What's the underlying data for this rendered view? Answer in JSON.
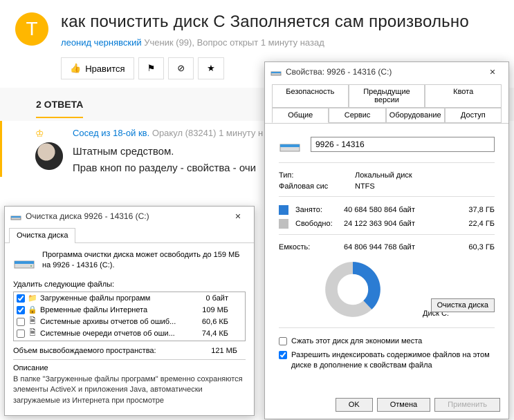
{
  "qa": {
    "avatar_letter": "Т",
    "title": "как почистить диск С Заполняется сам произвольно",
    "author": "леонид чернявский",
    "author_meta": "Ученик (99), Вопрос открыт 1 минуту назад",
    "like_label": "Нравится",
    "answers_label": "2 ОТВЕТА"
  },
  "answer": {
    "name": "Сосед из 18-ой кв.",
    "rank": "Оракул (83241)",
    "time": "1 минуту н",
    "line1": "Штатным средством.",
    "line2": "Прав кноп по разделу - свойства - очи"
  },
  "cleanup": {
    "title": "Очистка диска 9926 - 14316 (C:)",
    "tab": "Очистка диска",
    "info": "Программа очистки диска может освободить до 159 МБ на 9926 - 14316 (C:).",
    "list_label": "Удалить следующие файлы:",
    "items": [
      {
        "checked": true,
        "name": "Загруженные файлы программ",
        "size": "0 байт",
        "icon": "folder"
      },
      {
        "checked": true,
        "name": "Временные файлы Интернета",
        "size": "109 МБ",
        "icon": "lock"
      },
      {
        "checked": false,
        "name": "Системные архивы отчетов об ошиб...",
        "size": "60,6 КБ",
        "icon": "file"
      },
      {
        "checked": false,
        "name": "Системные очереди отчетов об оши...",
        "size": "74,4 КБ",
        "icon": "file"
      }
    ],
    "freed_label": "Объем высвобождаемого пространства:",
    "freed_value": "121 МБ",
    "desc_label": "Описание",
    "desc_text": "В папке \"Загруженные файлы программ\" временно сохраняются элементы ActiveX и приложения Java, автоматически загружаемые из Интернета при просмотре"
  },
  "props": {
    "title": "Свойства: 9926 - 14316 (C:)",
    "tabs_top": [
      "Безопасность",
      "Предыдущие версии",
      "Квота"
    ],
    "tabs_bottom": [
      "Общие",
      "Сервис",
      "Оборудование",
      "Доступ"
    ],
    "name_value": "9926 - 14316",
    "type_label": "Тип:",
    "type_value": "Локальный диск",
    "fs_label": "Файловая сис",
    "fs_value": "NTFS",
    "used_label": "Занято:",
    "used_bytes": "40 684 580 864 байт",
    "used_gb": "37,8 ГБ",
    "free_label": "Свободно:",
    "free_bytes": "24 122 363 904 байт",
    "free_gb": "22,4 ГБ",
    "cap_label": "Емкость:",
    "cap_bytes": "64 806 944 768 байт",
    "cap_gb": "60,3 ГБ",
    "disk_label": "Диск C:",
    "clean_btn": "Очистка диска",
    "compress_label": "Сжать этот диск для экономии места",
    "index_label": "Разрешить индексировать содержимое файлов на этом диске в дополнение к свойствам файла",
    "ok": "OK",
    "cancel": "Отмена",
    "apply": "Применить"
  }
}
